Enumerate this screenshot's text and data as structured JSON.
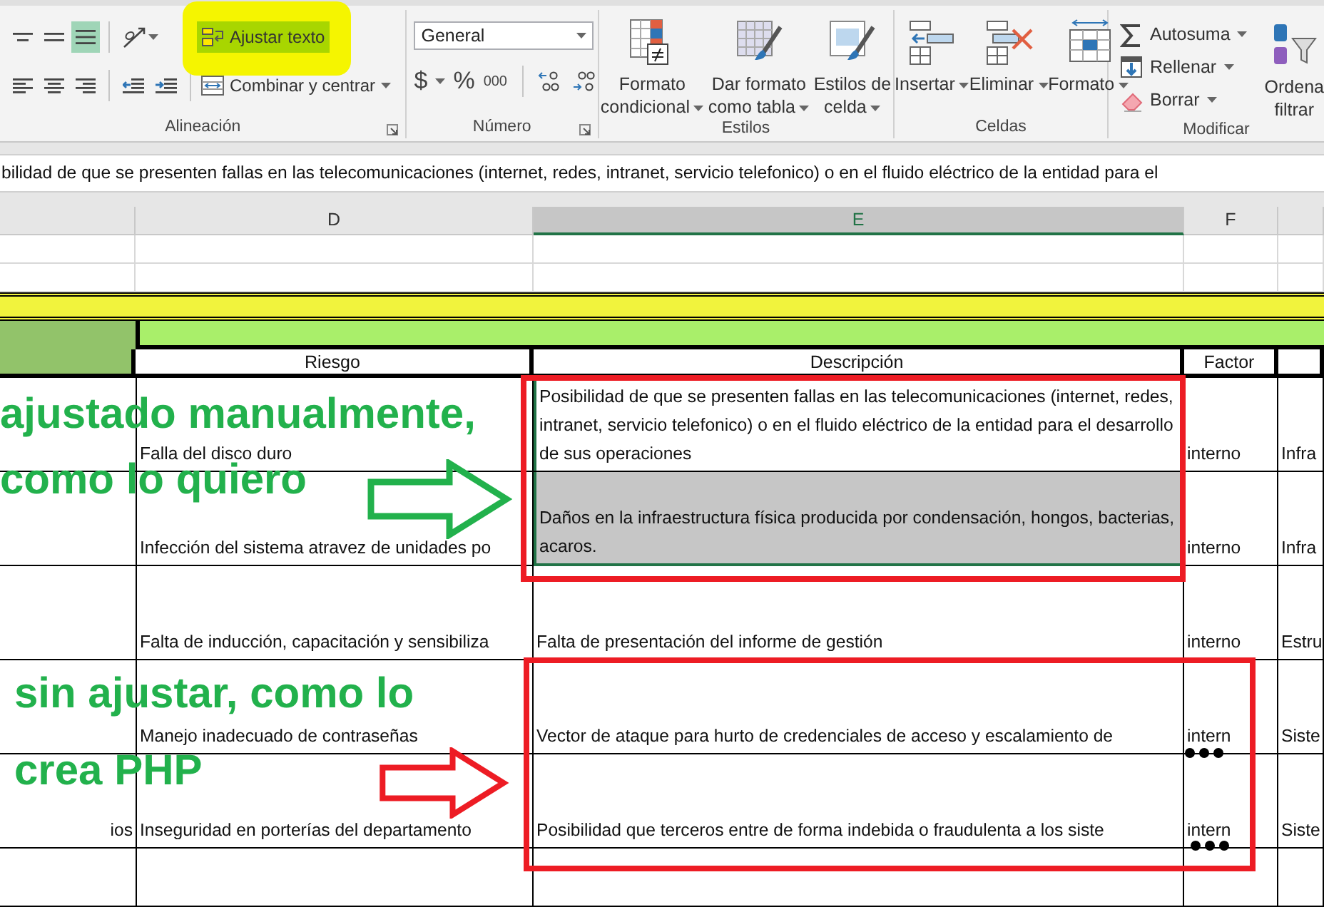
{
  "ribbon": {
    "alignment": {
      "label": "Alineación",
      "top_buttons": [
        {
          "kind": "align-top",
          "selected": false
        },
        {
          "kind": "align-middle",
          "selected": false
        },
        {
          "kind": "align-bottom",
          "selected": true
        },
        {
          "kind": "orientation",
          "selected": false
        }
      ],
      "bottom_buttons": [
        {
          "kind": "align-left",
          "selected": false
        },
        {
          "kind": "align-center",
          "selected": false
        },
        {
          "kind": "align-right",
          "selected": false
        },
        {
          "kind": "outdent",
          "selected": false
        },
        {
          "kind": "indent",
          "selected": false
        }
      ],
      "wrap_text": {
        "label": "Ajustar texto",
        "selected": true,
        "highlighted": true
      },
      "merge": {
        "label": "Combinar y centrar"
      }
    },
    "number": {
      "label": "Número",
      "format": "General",
      "currency": "$",
      "percent": "%",
      "thousands": "000"
    },
    "styles": {
      "label": "Estilos",
      "buttons": [
        {
          "kind": "conditional",
          "lines": [
            "Formato",
            "condicional"
          ]
        },
        {
          "kind": "table",
          "lines": [
            "Dar formato",
            "como tabla"
          ]
        },
        {
          "kind": "cell-styles",
          "lines": [
            "Estilos de",
            "celda"
          ]
        }
      ]
    },
    "cells": {
      "label": "Celdas",
      "buttons": [
        {
          "kind": "insert",
          "lines": [
            "Insertar"
          ]
        },
        {
          "kind": "delete",
          "lines": [
            "Eliminar"
          ]
        },
        {
          "kind": "format",
          "lines": [
            "Formato"
          ]
        }
      ]
    },
    "modify": {
      "label": "Modificar",
      "items": [
        {
          "kind": "sum",
          "label": "Autosuma"
        },
        {
          "kind": "fill",
          "label": "Rellenar"
        },
        {
          "kind": "clear",
          "label": "Borrar"
        }
      ],
      "sort": {
        "lines": [
          "Ordena",
          "filtrar"
        ]
      }
    }
  },
  "formula_bar": {
    "value": "bilidad de que se presenten fallas en las telecomunicaciones (internet, redes, intranet, servicio telefonico) o en el fluido eléctrico de la entidad para el"
  },
  "sheet": {
    "columns": [
      {
        "selected": false
      },
      {
        "label": "D",
        "selected": false
      },
      {
        "label": "E",
        "selected": true
      },
      {
        "label": "F",
        "selected": false
      },
      {
        "selected": false
      }
    ],
    "rows": [
      {
        "kind": "blank"
      },
      {
        "kind": "blank"
      },
      {
        "kind": "title-band"
      },
      {
        "kind": "section-band"
      },
      {
        "kind": "header",
        "risk": "Riesgo",
        "description": "Descripción",
        "factor": "Factor"
      },
      {
        "kind": "data",
        "risk": "Falla del disco duro",
        "description": "Posibilidad de que se presenten fallas en las telecomunicaciones (internet, redes, intranet, servicio telefonico) o en el fluido eléctrico de la entidad para el desarrollo de sus operaciones",
        "factor": "interno",
        "column_g": "Infra",
        "selected": true,
        "wrapped": true
      },
      {
        "kind": "data",
        "risk": "Infección del sistema atravez de unidades po",
        "description": "Daños en la infraestructura física producida por condensación, hongos, bacterias, acaros.",
        "factor": "interno",
        "column_g": "Infra",
        "selected": true,
        "wrapped": true
      },
      {
        "kind": "data",
        "risk": "Falta de inducción, capacitación  y sensibiliza",
        "description": "Falta de presentación del informe de gestión",
        "factor": "interno",
        "column_g": "Estru",
        "selected": false
      },
      {
        "kind": "data",
        "risk": "Manejo inadecuado de contraseñas",
        "description": "Vector de ataque para hurto de credenciales de acceso y escalamiento de",
        "factor": "intern",
        "column_g": "Siste",
        "selected": false
      },
      {
        "kind": "data",
        "column_c": "ios",
        "risk": "Inseguridad en porterías del departamento",
        "description": "Posibilidad que terceros entre de forma indebida o fraudulenta a los siste",
        "factor": "intern",
        "column_g": "Siste",
        "selected": false
      },
      {
        "kind": "empty"
      }
    ]
  },
  "annotations": [
    {
      "kind": "note",
      "lines": [
        "ajustado manualmente,",
        "como lo quiero"
      ],
      "color": "#22b14c"
    },
    {
      "kind": "note",
      "lines": [
        "sin ajustar, como lo",
        "crea PHP"
      ],
      "color": "#22b14c"
    },
    {
      "kind": "arrow",
      "color": "#22b14c"
    },
    {
      "kind": "arrow",
      "color": "#ed1c24"
    },
    {
      "kind": "frame",
      "color": "#ed1c24"
    },
    {
      "kind": "frame",
      "color": "#ed1c24"
    },
    {
      "kind": "dots",
      "color": "#000000"
    },
    {
      "kind": "dots",
      "color": "#000000"
    }
  ]
}
